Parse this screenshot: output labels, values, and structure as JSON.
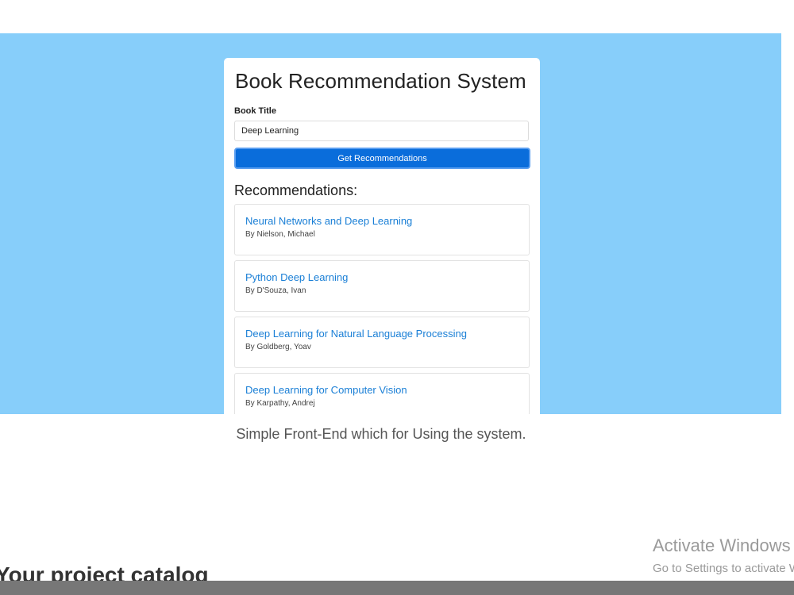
{
  "app": {
    "title": "Book Recommendation System",
    "field_label": "Book Title",
    "input_value": "Deep Learning",
    "button_label": "Get Recommendations",
    "recommendations_heading": "Recommendations:"
  },
  "recommendations": [
    {
      "title": "Neural Networks and Deep Learning",
      "author": "By Nielson, Michael"
    },
    {
      "title": "Python Deep Learning",
      "author": "By D'Souza, Ivan"
    },
    {
      "title": "Deep Learning for Natural Language Processing",
      "author": "By Goldberg, Yoav"
    },
    {
      "title": "Deep Learning for Computer Vision",
      "author": "By Karpathy, Andrej"
    }
  ],
  "caption": "Simple Front-End which for Using the system.",
  "footer_heading": "Your project catalog",
  "watermark": {
    "title": "Activate Windows",
    "subtitle": "Go to Settings to activate Windows."
  },
  "colors": {
    "hero_background": "#87cefa",
    "button": "#0a6ddb",
    "link": "#1a7fd6"
  }
}
